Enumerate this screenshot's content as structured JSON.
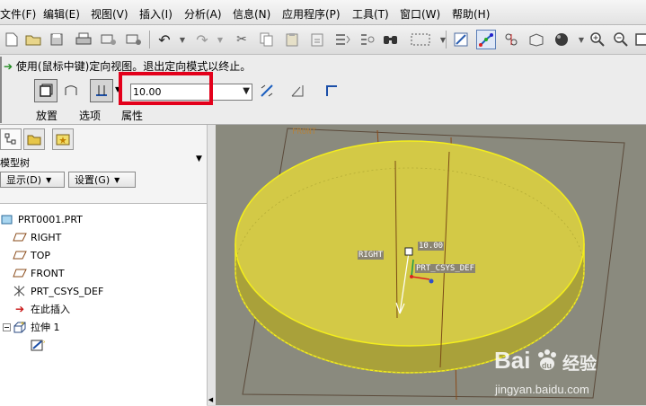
{
  "menu": [
    "文件(F)",
    "编辑(E)",
    "视图(V)",
    "插入(I)",
    "分析(A)",
    "信息(N)",
    "应用程序(P)",
    "工具(T)",
    "窗口(W)",
    "帮助(H)"
  ],
  "toolbar": {
    "icons": [
      "new-file-icon",
      "open-folder-icon",
      "save-icon",
      "print-icon",
      "send-mail-icon",
      "mail-icon",
      "undo-icon",
      "redo-icon",
      "cut-icon",
      "copy-icon",
      "paste-icon",
      "paste-special-icon",
      "regenerate-icon",
      "model-player-icon",
      "find-icon",
      "select-box-icon",
      "repaint-icon",
      "spin-center-icon",
      "view-manager-icon",
      "orient-icon",
      "shading-icon",
      "zoom-in-icon",
      "zoom-out-icon",
      "refit-icon"
    ]
  },
  "dashboard": {
    "message": "使用(鼠标中键)定向视图。退出定向模式以终止。",
    "depth_value": "10.00",
    "tabs": [
      "放置",
      "选项",
      "属性"
    ]
  },
  "model_tree": {
    "title": "模型树",
    "show_button": "显示(D)",
    "settings_button": "设置(G)",
    "nodes": [
      {
        "label": "PRT0001.PRT",
        "icon": "part-icon"
      },
      {
        "label": "RIGHT",
        "icon": "datum-plane-icon"
      },
      {
        "label": "TOP",
        "icon": "datum-plane-icon"
      },
      {
        "label": "FRONT",
        "icon": "datum-plane-icon"
      },
      {
        "label": "PRT_CSYS_DEF",
        "icon": "coordinate-system-icon"
      },
      {
        "label": "在此插入",
        "icon": "insert-here-arrow-icon"
      },
      {
        "label": "拉伸 1",
        "icon": "extrude-feature-icon"
      },
      {
        "label": "",
        "icon": "sketch-icon"
      }
    ]
  },
  "viewport": {
    "labels": {
      "front": "FRONT",
      "right": "RIGHT",
      "depth": "10.00",
      "csys": "PRT_CSYS_DEF"
    },
    "shape_color": "#d3c946",
    "edge_color": "#f4ee1c"
  },
  "watermark": {
    "logo": "Bai",
    "paw": "du",
    "cn": "经验",
    "url": "jingyan.baidu.com"
  }
}
